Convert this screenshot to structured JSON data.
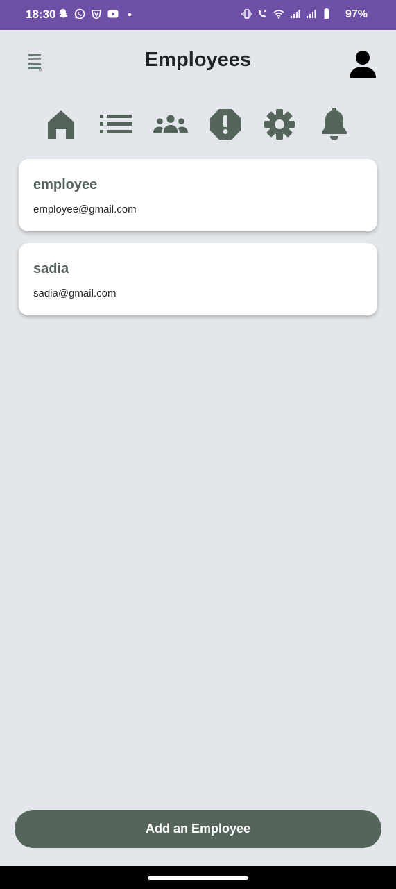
{
  "status_bar": {
    "time": "18:30",
    "battery": "97%",
    "left_icons": [
      "snapchat-icon",
      "whatsapp-icon",
      "vpn-icon",
      "youtube-icon",
      "dot-icon"
    ],
    "right_icons": [
      "vibrate-icon",
      "call-signal-icon",
      "wifi-icon",
      "signal-icon",
      "signal-icon",
      "battery-icon"
    ],
    "bg_color": "#6e4fa6"
  },
  "header": {
    "title": "Employees",
    "menu_icon": "menu-icon",
    "profile_icon": "person-icon"
  },
  "nav": {
    "icons": [
      "home-icon",
      "list-icon",
      "group-icon",
      "alert-icon",
      "gear-icon",
      "bell-icon"
    ],
    "color": "#55655b"
  },
  "employees": [
    {
      "name": "employee",
      "email": "employee@gmail.com"
    },
    {
      "name": "sadia",
      "email": "sadia@gmail.com"
    }
  ],
  "actions": {
    "add_label": "Add an Employee",
    "button_color": "#55655b"
  },
  "colors": {
    "background": "#e3e6ea",
    "accent": "#55655b"
  }
}
